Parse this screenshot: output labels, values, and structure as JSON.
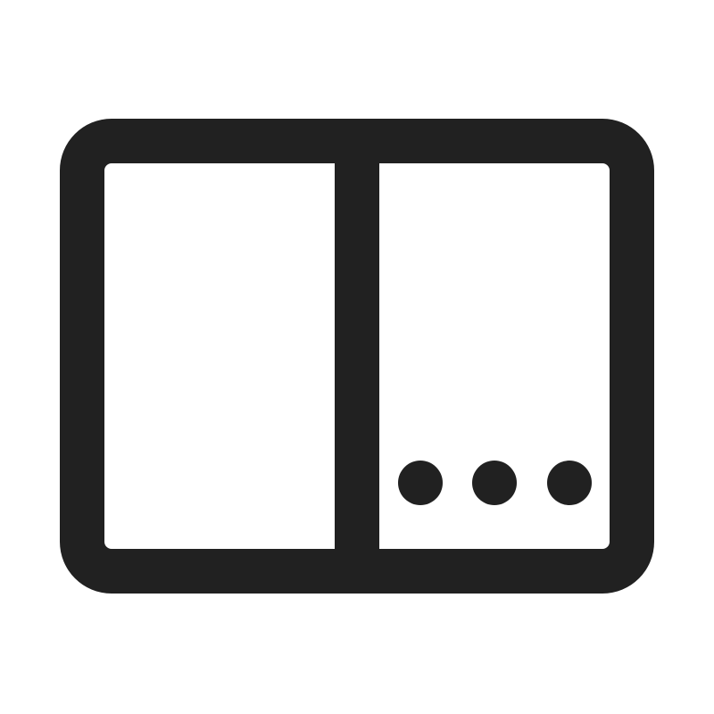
{
  "icon": {
    "name": "split-panel-more-icon",
    "color": "#212121",
    "background": "#ffffff"
  }
}
